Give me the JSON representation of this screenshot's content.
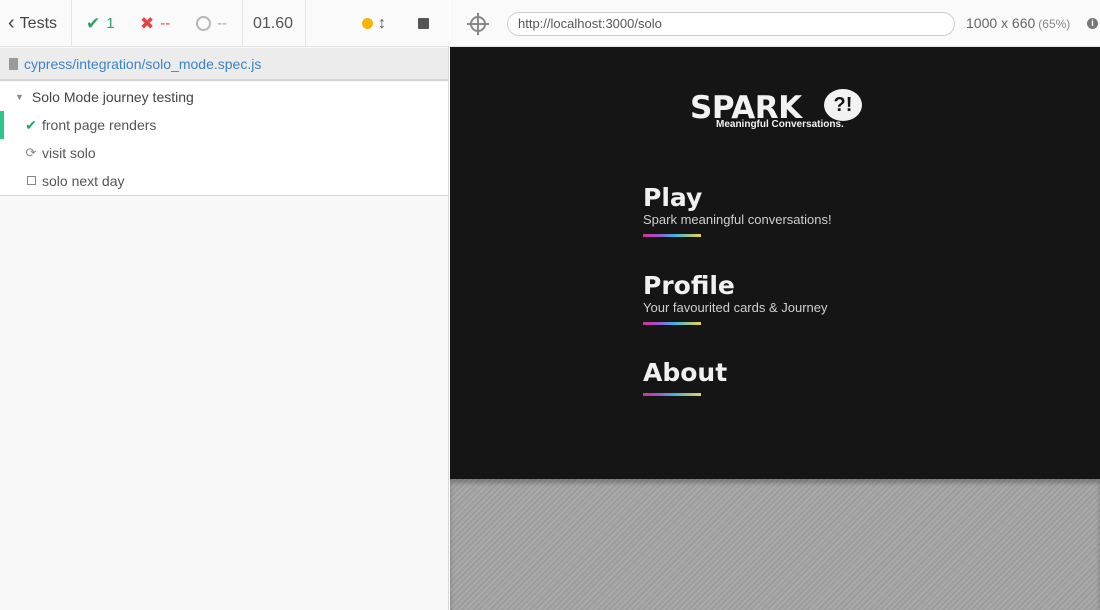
{
  "runner": {
    "back_label": "Tests",
    "passed_count": "1",
    "failed_count": "--",
    "pending_count": "--",
    "duration": "01.60",
    "spec_path": "cypress/integration/solo_mode.spec.js",
    "suite": {
      "title": "Solo Mode journey testing",
      "tests": [
        {
          "label": "front page renders",
          "state": "passed",
          "icon": "check-icon"
        },
        {
          "label": "visit solo",
          "state": "running",
          "icon": "spinner-icon"
        },
        {
          "label": "solo next day",
          "state": "pending",
          "icon": "checkbox-icon"
        }
      ]
    },
    "colors": {
      "passed": "#2da36b",
      "failed": "#e04646",
      "status_dot": "#f4b400",
      "active_bar": "#2dc78b",
      "link": "#3b83c9"
    }
  },
  "preview": {
    "url": "http://localhost:3000/solo",
    "viewport_size": "1000 x 660",
    "scale": "(65%)"
  },
  "app": {
    "logo_word": "SPARK",
    "logo_bubble": "?!",
    "logo_tagline": "Meaningful Conversations.",
    "menu": [
      {
        "title": "Play",
        "subtitle": "Spark meaningful conversations!"
      },
      {
        "title": "Profile",
        "subtitle": "Your favourited cards & Journey"
      },
      {
        "title": "About",
        "subtitle": ""
      }
    ],
    "colors": {
      "background": "#151515",
      "text": "#f0f0f0"
    }
  }
}
